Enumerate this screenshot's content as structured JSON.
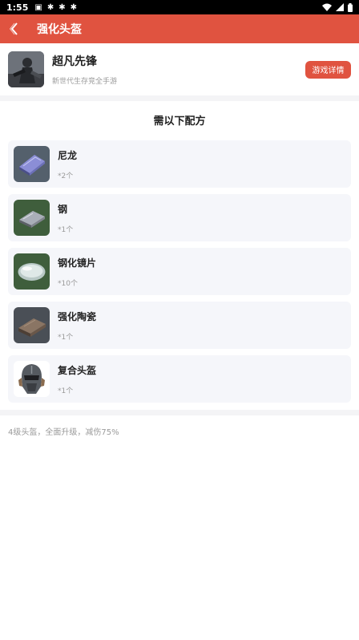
{
  "status": {
    "time": "1:55"
  },
  "appbar": {
    "title": "强化头盔"
  },
  "game": {
    "name": "超凡先锋",
    "subtitle": "新世代生存竞全手游",
    "detail_button": "游戏详情"
  },
  "recipe": {
    "title": "需以下配方",
    "items": [
      {
        "name": "尼龙",
        "qty": "*2个"
      },
      {
        "name": "钢",
        "qty": "*1个"
      },
      {
        "name": "钢化镜片",
        "qty": "*10个"
      },
      {
        "name": "强化陶瓷",
        "qty": "*1个"
      },
      {
        "name": "复合头盔",
        "qty": "*1个"
      }
    ]
  },
  "description": "4级头盔，全面升级，减伤75%"
}
